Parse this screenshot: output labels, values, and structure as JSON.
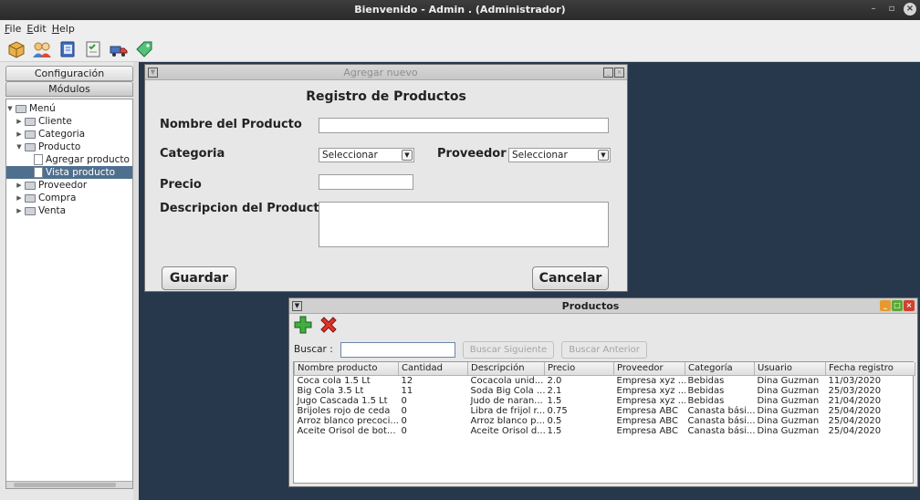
{
  "window": {
    "title": "Bienvenido - Admin . (Administrador)"
  },
  "menubar": {
    "items": [
      "File",
      "Edit",
      "Help"
    ]
  },
  "toolbar": {
    "icons": [
      "box-icon",
      "users-icon",
      "notebook-icon",
      "checklist-icon",
      "truck-icon",
      "tag-icon"
    ]
  },
  "sidebar": {
    "tab_config": "Configuración",
    "tab_modules": "Módulos",
    "tree": [
      {
        "label": "Menú",
        "level": 0,
        "type": "folder",
        "expanded": true
      },
      {
        "label": "Cliente",
        "level": 1,
        "type": "folder",
        "expanded": false
      },
      {
        "label": "Categoria",
        "level": 1,
        "type": "folder",
        "expanded": false
      },
      {
        "label": "Producto",
        "level": 1,
        "type": "folder",
        "expanded": true
      },
      {
        "label": "Agregar producto",
        "level": 2,
        "type": "file"
      },
      {
        "label": "Vista producto",
        "level": 2,
        "type": "file",
        "selected": true
      },
      {
        "label": "Proveedor",
        "level": 1,
        "type": "folder",
        "expanded": false
      },
      {
        "label": "Compra",
        "level": 1,
        "type": "folder",
        "expanded": false
      },
      {
        "label": "Venta",
        "level": 1,
        "type": "folder",
        "expanded": false
      }
    ]
  },
  "form": {
    "frame_title": "Agregar nuevo",
    "heading": "Registro de Productos",
    "name_label": "Nombre del Producto",
    "category_label": "Categoria",
    "category_value": "Seleccionar",
    "supplier_label": "Proveedor",
    "supplier_value": "Seleccionar",
    "price_label": "Precio",
    "description_label": "Descripcion del Producto",
    "save_label": "Guardar",
    "cancel_label": "Cancelar"
  },
  "products": {
    "frame_title": "Productos",
    "search_label": "Buscar :",
    "next_label": "Buscar Siguiente",
    "prev_label": "Buscar Anterior",
    "columns": [
      "Nombre producto",
      "Cantidad",
      "Descripción",
      "Precio",
      "Proveedor",
      "Categoría",
      "Usuario",
      "Fecha registro"
    ],
    "rows": [
      [
        "Coca cola 1.5 Lt",
        "12",
        "Cocacola unid...",
        "2.0",
        "Empresa xyz ...",
        "Bebidas",
        "Dina Guzman",
        "11/03/2020"
      ],
      [
        "Big Cola 3.5 Lt",
        "11",
        "Soda Big Cola ...",
        "2.1",
        "Empresa xyz ...",
        "Bebidas",
        "Dina Guzman",
        "25/03/2020"
      ],
      [
        "Jugo Cascada 1.5 Lt",
        "0",
        "Judo de naran...",
        "1.5",
        "Empresa xyz ...",
        "Bebidas",
        "Dina Guzman",
        "21/04/2020"
      ],
      [
        "Brijoles rojo de ceda",
        "0",
        "Libra de frijol r...",
        "0.75",
        "Empresa ABC",
        "Canasta bási...",
        "Dina Guzman",
        "25/04/2020"
      ],
      [
        "Arroz blanco precoci...",
        "0",
        "Arroz blanco p...",
        "0.5",
        "Empresa ABC",
        "Canasta bási...",
        "Dina Guzman",
        "25/04/2020"
      ],
      [
        "Aceite Orisol de bot...",
        "0",
        "Aceite Orisol d...",
        "1.5",
        "Empresa ABC",
        "Canasta bási...",
        "Dina Guzman",
        "25/04/2020"
      ]
    ]
  },
  "colors": {
    "desktop": "#27384c",
    "selection": "#4f6f8f"
  }
}
